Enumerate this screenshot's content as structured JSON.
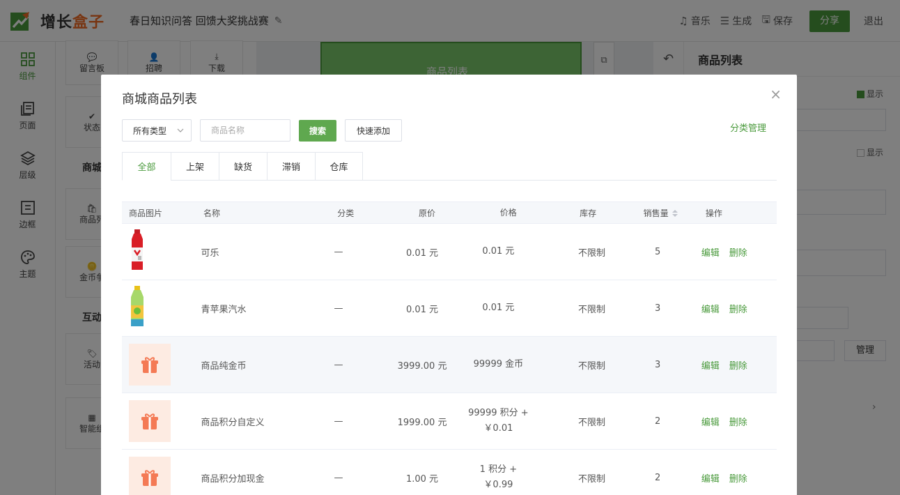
{
  "topbar": {
    "logo_prefix": "增长",
    "logo_suffix": "盒子",
    "project_title": "春日知识问答 回馈大奖挑战赛",
    "music": "音乐",
    "generate": "生成",
    "save": "保存",
    "share": "分享",
    "logout": "退出"
  },
  "sidebar": {
    "items": [
      {
        "label": "组件",
        "icon": "grid-icon"
      },
      {
        "label": "页面",
        "icon": "pages-icon"
      },
      {
        "label": "层级",
        "icon": "layers-icon"
      },
      {
        "label": "边框",
        "icon": "border-icon"
      },
      {
        "label": "主题",
        "icon": "palette-icon"
      }
    ]
  },
  "component_panel": {
    "tiles": [
      "留言板",
      "招聘",
      "下载",
      "状态",
      "商品列",
      "金币争",
      "活动",
      "智能组"
    ],
    "sections": [
      "商城",
      "互动"
    ]
  },
  "canvas": {
    "header_title": "商品列表"
  },
  "right_panel": {
    "title": "商品列表",
    "show_1": "显示",
    "show_2": "显示",
    "manage": "管理"
  },
  "modal": {
    "title": "商城商品列表",
    "type_select": "所有类型",
    "search_placeholder": "商品名称",
    "search_btn": "搜索",
    "quick_add": "快速添加",
    "category_manage": "分类管理",
    "tabs": [
      "全部",
      "上架",
      "缺货",
      "滞销",
      "仓库"
    ],
    "active_tab": 0,
    "columns": {
      "image": "商品图片",
      "name": "名称",
      "category": "分类",
      "original_price": "原价",
      "price": "价格",
      "stock": "库存",
      "sales": "销售量",
      "actions": "操作"
    },
    "rows": [
      {
        "image": "cola-bottle-image",
        "name": "可乐",
        "category": "—",
        "original_price": "0.01 元",
        "price": "0.01 元",
        "stock": "不限制",
        "sales": "5"
      },
      {
        "image": "green-apple-soda-image",
        "name": "青苹果汽水",
        "category": "—",
        "original_price": "0.01 元",
        "price": "0.01 元",
        "stock": "不限制",
        "sales": "3"
      },
      {
        "image": "gift-icon",
        "name": "商品纯金币",
        "category": "—",
        "original_price": "3999.00 元",
        "price": "99999 金币",
        "stock": "不限制",
        "sales": "3"
      },
      {
        "image": "gift-icon",
        "name": "商品积分自定义",
        "category": "—",
        "original_price": "1999.00 元",
        "price": "99999 积分 + ￥0.01",
        "stock": "不限制",
        "sales": "2"
      },
      {
        "image": "gift-icon",
        "name": "商品积分加现金",
        "category": "—",
        "original_price": "1.00 元",
        "price": "1 积分 + ￥0.99",
        "stock": "不限制",
        "sales": "2"
      }
    ],
    "edit_label": "编辑",
    "delete_label": "删除"
  },
  "colors": {
    "accent": "#4a9a3c",
    "logo_orange": "#f06b24",
    "gift_bg": "#fdebe2"
  }
}
